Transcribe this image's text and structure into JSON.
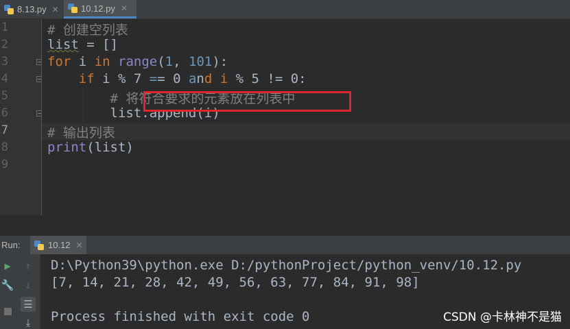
{
  "tabs": [
    {
      "label": "8.13.py",
      "active": false
    },
    {
      "label": "10.12.py",
      "active": true
    }
  ],
  "editor": {
    "line_numbers": [
      "1",
      "2",
      "3",
      "4",
      "5",
      "6",
      "7",
      "8",
      "9"
    ],
    "current_line": "7",
    "lines": [
      "# 创建空列表",
      "list = []",
      "for i in range(1, 101):",
      "    if i % 7 == 0 and i % 5 != 0:",
      "        # 将符合要求的元素放在列表中",
      "        list.append(i)",
      "# 输出列表",
      "print(list)",
      ""
    ]
  },
  "run_panel": {
    "label": "Run:",
    "tab_label": "10.12",
    "output": [
      "D:\\Python39\\python.exe D:/pythonProject/python_venv/10.12.py",
      "[7, 14, 21, 28, 42, 49, 56, 63, 77, 84, 91, 98]",
      "",
      "Process finished with exit code 0"
    ]
  },
  "watermark": "CSDN @卡林神不是猫",
  "colors": {
    "background": "#2b2b2b",
    "keyword": "#cc7832",
    "number": "#6897bb",
    "comment": "#808080",
    "builtin": "#8888c6",
    "highlight_box": "#e0262a"
  },
  "icons": [
    "python-file-icon",
    "close-icon",
    "run-icon",
    "wrench-icon",
    "stop-icon",
    "up-arrow-icon",
    "down-arrow-icon",
    "soft-wrap-icon",
    "scroll-to-end-icon"
  ]
}
